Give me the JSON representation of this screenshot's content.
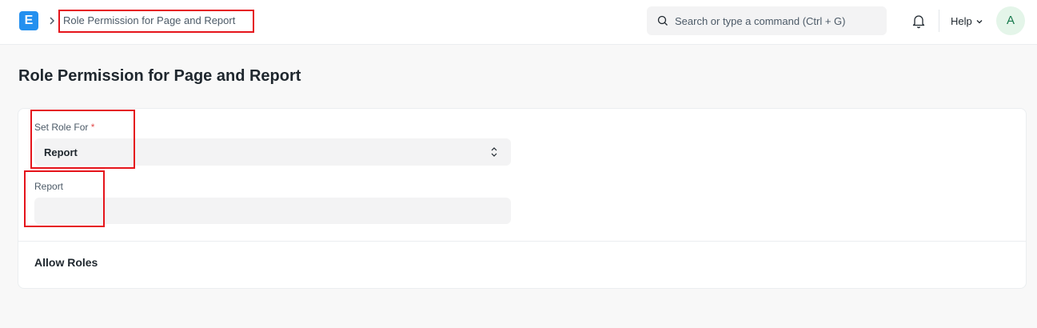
{
  "navbar": {
    "logo_letter": "E",
    "breadcrumb": "Role Permission for Page and Report",
    "search_placeholder": "Search or type a command (Ctrl + G)",
    "help_label": "Help",
    "avatar_initial": "A",
    "icons": [
      "app-logo",
      "chevron-right-icon",
      "search-icon",
      "bell-icon",
      "chevron-down-icon"
    ]
  },
  "page": {
    "title": "Role Permission for Page and Report"
  },
  "form": {
    "set_role_for": {
      "label": "Set Role For",
      "required_mark": "*",
      "value": "Report"
    },
    "report": {
      "label": "Report",
      "value": ""
    },
    "section_title": "Allow Roles"
  },
  "colors": {
    "accent": "#2490ef",
    "annotation": "#e5141b",
    "avatar_bg": "#e4f5e9",
    "avatar_fg": "#16794c"
  }
}
